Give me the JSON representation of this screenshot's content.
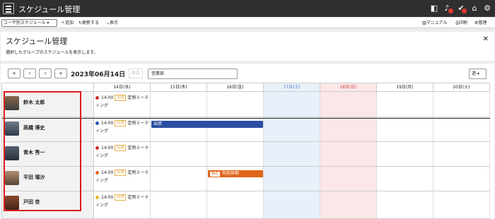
{
  "app": {
    "title": "スケジュール管理",
    "icons": [
      "menu-icon",
      "book-icon",
      "bell-icon",
      "check-icon",
      "home-icon",
      "gear-icon"
    ],
    "notification_count": "2"
  },
  "toolbar": {
    "view_select": "ユーザ別スケジュール",
    "add_label": "追加",
    "refresh_label": "更新する",
    "display_label": "表示",
    "manual_label": "マニュアル",
    "print_label": "印刷",
    "admin_label": "管理"
  },
  "panel": {
    "title": "スケジュール管理",
    "description": "選択したグループのスケジュールを表示します。"
  },
  "calendar": {
    "current_date": "2023年06月14日",
    "today_label": "本日",
    "group_select": "営業部",
    "view_select": "週",
    "days": [
      {
        "label": "14日(水)",
        "type": "weekday"
      },
      {
        "label": "15日(木)",
        "type": "weekday"
      },
      {
        "label": "16日(金)",
        "type": "weekday"
      },
      {
        "label": "17日(土)",
        "type": "sat"
      },
      {
        "label": "18日(日)",
        "type": "sun"
      },
      {
        "label": "19日(月)",
        "type": "weekday"
      },
      {
        "label": "20日(火)",
        "type": "weekday"
      }
    ],
    "users": [
      {
        "name": "鈴木 太郎",
        "event_time": "14:00",
        "event_tag": "会議",
        "event_title": "定例ミーティング",
        "dot_color": "#c9302c"
      },
      {
        "name": "高橋 博史",
        "event_time": "14:00",
        "event_tag": "会議",
        "event_title": "定例ミーティング",
        "dot_color": "#2c56b5"
      },
      {
        "name": "青木 秀一",
        "event_time": "14:00",
        "event_tag": "会議",
        "event_title": "定例ミーティング",
        "dot_color": "#c9302c"
      },
      {
        "name": "平田 瑠沙",
        "event_time": "14:00",
        "event_tag": "会議",
        "event_title": "定例ミーティング",
        "dot_color": "#e0651a"
      },
      {
        "name": "戸田 杏",
        "event_time": "14:00",
        "event_tag": "会議",
        "event_title": "定例ミーティング",
        "dot_color": "#e8b82c"
      }
    ],
    "bars": [
      {
        "label": "出張",
        "color": "#2a4fa0"
      },
      {
        "label": "有給休暇",
        "tag": "休み",
        "color": "#e0651a"
      }
    ]
  }
}
